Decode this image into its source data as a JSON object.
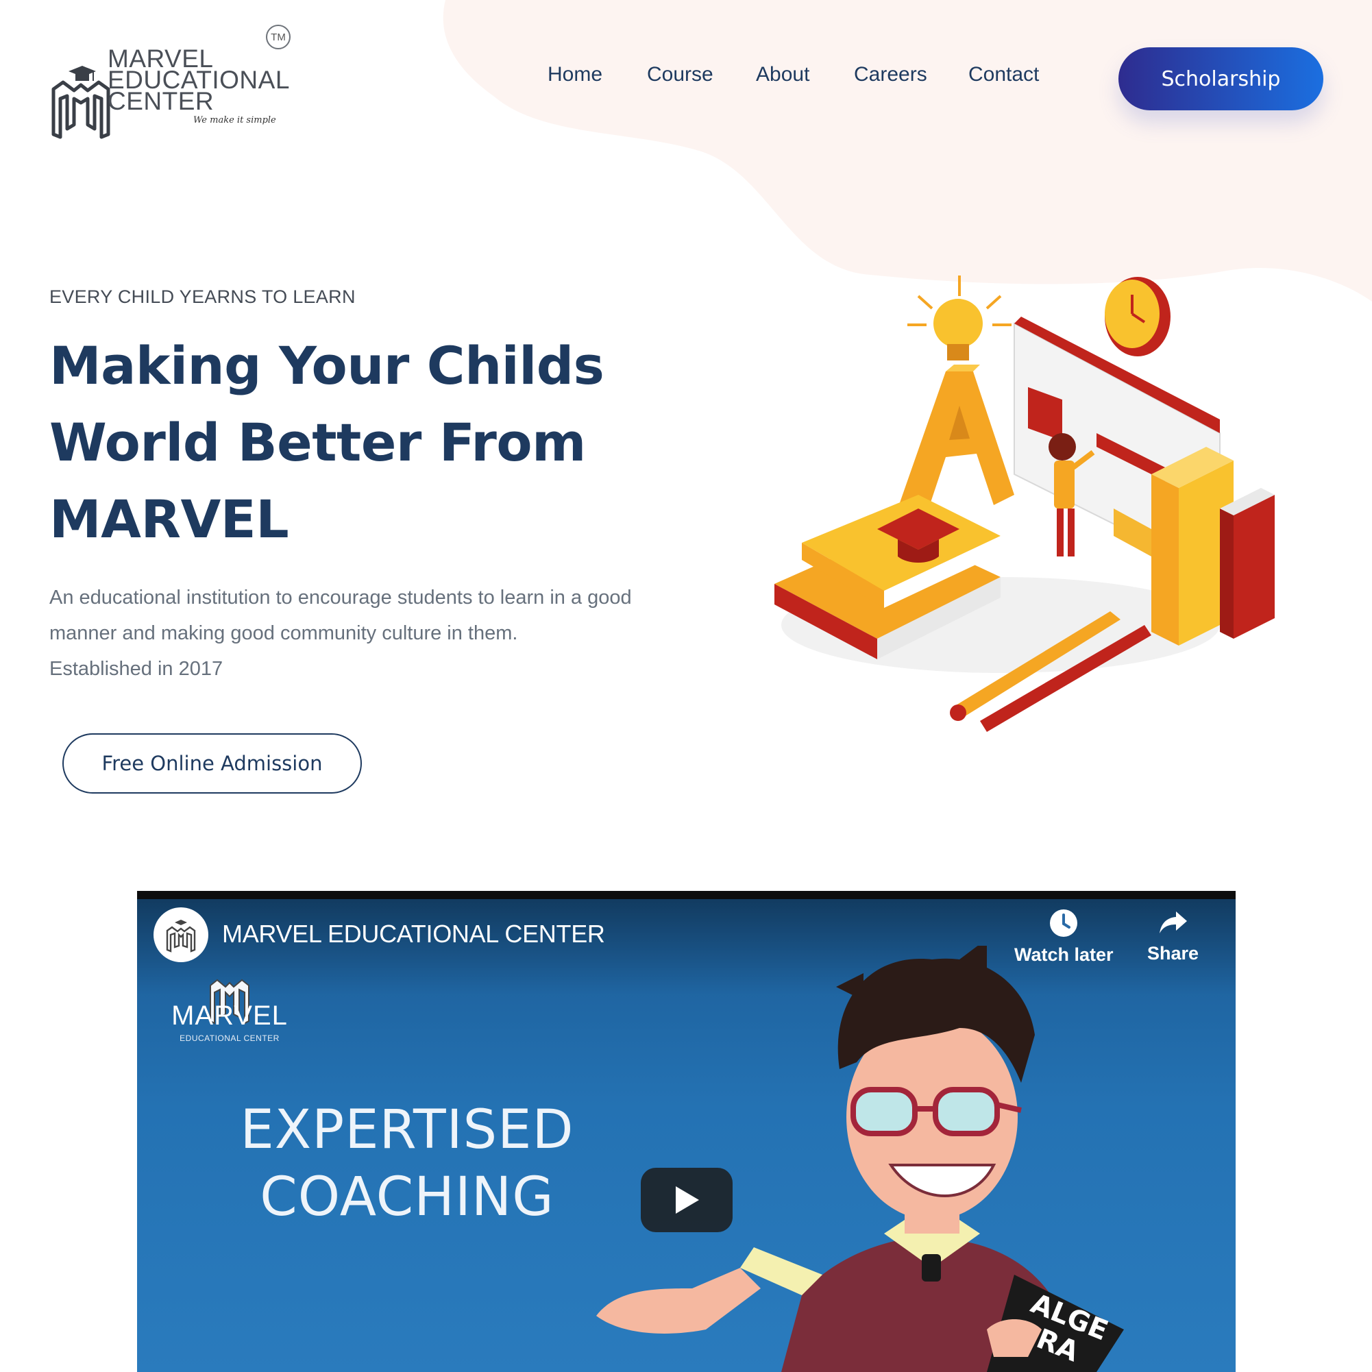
{
  "header": {
    "logo": {
      "line1": "MARVEL",
      "line2": "EDUCATIONAL",
      "line3": "CENTER",
      "trademark": "TM",
      "tagline": "We make it simple"
    },
    "nav": [
      {
        "label": "Home"
      },
      {
        "label": "Course"
      },
      {
        "label": "About"
      },
      {
        "label": "Careers"
      },
      {
        "label": "Contact"
      }
    ],
    "cta_label": "Scholarship"
  },
  "hero": {
    "eyebrow": "EVERY CHILD YEARNS TO LEARN",
    "headline": [
      "Making Your Childs",
      "World Better From",
      "MARVEL"
    ],
    "lead": [
      "An educational institution to encourage students to learn in a good",
      "manner and making good community culture in them.",
      "Established in 2017"
    ],
    "admission_label": "Free Online Admission"
  },
  "video": {
    "channel_title": "MARVEL EDUCATIONAL CENTER",
    "watch_later_label": "Watch later",
    "share_label": "Share",
    "logo_word": "MARVEL",
    "logo_sub": "EDUCATIONAL CENTER",
    "headline": [
      "EXPERTISED",
      "COACHING"
    ],
    "book_text_1": "ALGE",
    "book_text_2": "BRA"
  },
  "colors": {
    "navy": "#1e3a5f",
    "accent_gradient_start": "#2e2c8f",
    "accent_gradient_end": "#1b6fe0",
    "hero_blob": "#fdf4f1",
    "video_bg": "#2472b3"
  },
  "icons": [
    "marvel-logo-icon",
    "clock-icon",
    "share-arrow-icon",
    "play-icon"
  ]
}
